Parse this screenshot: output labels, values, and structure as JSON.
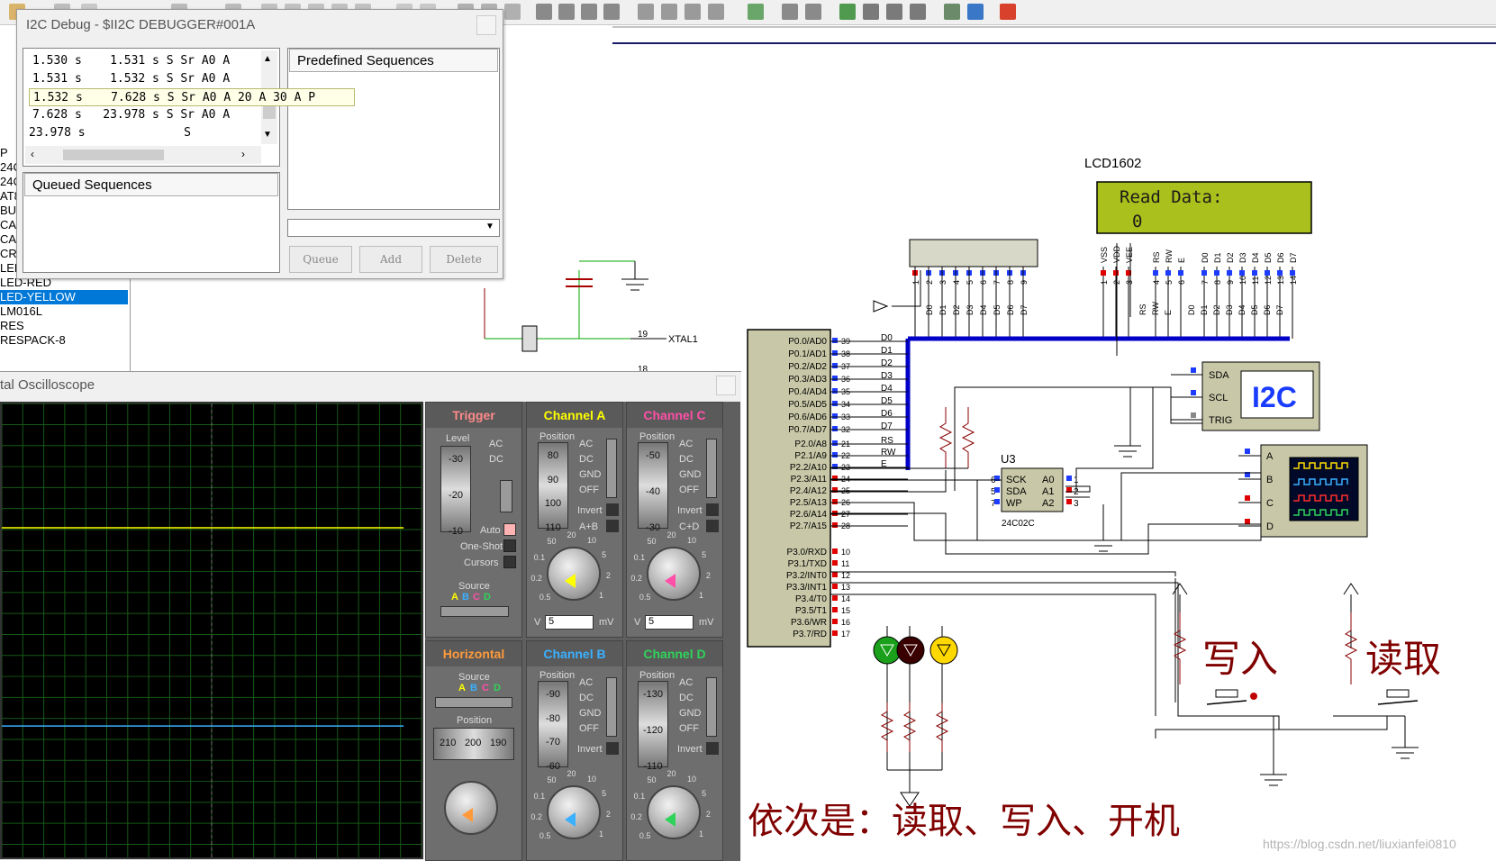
{
  "toolbar": {
    "label": "schematic-toolbar"
  },
  "i2c_window": {
    "title": "I2C Debug - $II2C DEBUGGER#001A",
    "trace_rows": [
      "1.530 s    1.531 s S Sr A0 A",
      "1.531 s    1.532 s S Sr A0 A",
      "1.532 s    7.628 s S Sr A0 A 20 A 30 A P",
      "7.628 s   23.978 s S Sr A0 A",
      "23.978 s              S"
    ],
    "predefined_label": "Predefined Sequences",
    "queued_label": "Queued Sequences",
    "buttons": {
      "queue": "Queue",
      "add": "Add",
      "delete": "Delete"
    }
  },
  "component_list": {
    "items": [
      "P",
      "24C",
      "24C",
      "AT8",
      "BUT",
      "CAR",
      "CAR",
      "CRY",
      "LED-GREEN",
      "LED-RED",
      "LED-YELLOW",
      "LM016L",
      "RES",
      "RESPACK-8"
    ],
    "selected_index": 10
  },
  "oscilloscope": {
    "title": "tal Oscilloscope",
    "trigger": {
      "title": "Trigger",
      "level_label": "Level",
      "ac": "AC",
      "dc": "DC",
      "auto": "Auto",
      "one_shot": "One-Shot",
      "cursors": "Cursors",
      "source": "Source",
      "scale": [
        "-30",
        "-20",
        "-10"
      ]
    },
    "horizontal": {
      "title": "Horizontal",
      "source": "Source",
      "position": "Position",
      "scale": [
        "210",
        "200",
        "190"
      ]
    },
    "source_letters": [
      "A",
      "B",
      "C",
      "D"
    ],
    "channels": [
      {
        "title": "Channel A",
        "color": "#ffff00",
        "position": "Position",
        "scale": [
          "80",
          "90",
          "100",
          "110"
        ],
        "coupling": [
          "AC",
          "DC",
          "GND",
          "OFF"
        ],
        "invert": "Invert",
        "extra": "A+B",
        "volts": "5",
        "unit_left": "V",
        "unit_right": "mV"
      },
      {
        "title": "Channel C",
        "color": "#ff4fa8",
        "position": "Position",
        "scale": [
          "-50",
          "-40",
          "-30"
        ],
        "coupling": [
          "AC",
          "DC",
          "GND",
          "OFF"
        ],
        "invert": "Invert",
        "extra": "C+D",
        "volts": "5",
        "unit_left": "V",
        "unit_right": "mV"
      },
      {
        "title": "Channel B",
        "color": "#3ab0ff",
        "position": "Position",
        "scale": [
          "-90",
          "-80",
          "-70",
          "-60"
        ],
        "coupling": [
          "AC",
          "DC",
          "GND",
          "OFF"
        ],
        "invert": "Invert"
      },
      {
        "title": "Channel D",
        "color": "#2fd35a",
        "position": "Position",
        "scale": [
          "-130",
          "-120",
          "-110"
        ],
        "coupling": [
          "AC",
          "DC",
          "GND",
          "OFF"
        ],
        "invert": "Invert"
      }
    ],
    "dial_labels": [
      "0.5",
      "0.2",
      "0.1",
      "50",
      "20",
      "10",
      "5",
      "2",
      "1"
    ]
  },
  "schematic": {
    "lcd_label": "LCD1602",
    "lcd_line1": "Read Data:",
    "lcd_line2": "0",
    "mcu_pins_left": [
      "19",
      "18"
    ],
    "xtal1": "XTAL1",
    "p0_pins": [
      "P0.0/AD0",
      "P0.1/AD1",
      "P0.2/AD2",
      "P0.3/AD3",
      "P0.4/AD4",
      "P0.5/AD5",
      "P0.6/AD6",
      "P0.7/AD7"
    ],
    "p0_nums": [
      "39",
      "38",
      "37",
      "36",
      "35",
      "34",
      "33",
      "32"
    ],
    "p0_nets": [
      "D0",
      "D1",
      "D2",
      "D3",
      "D4",
      "D5",
      "D6",
      "D7"
    ],
    "p2_pins": [
      "P2.0/A8",
      "P2.1/A9",
      "P2.2/A10",
      "P2.3/A11",
      "P2.4/A12",
      "P2.5/A13",
      "P2.6/A14",
      "P2.7/A15"
    ],
    "p2_nums": [
      "21",
      "22",
      "23",
      "24",
      "25",
      "26",
      "27",
      "28"
    ],
    "p2_nets": [
      "RS",
      "RW",
      "E"
    ],
    "p3_pins": [
      "P3.0/RXD",
      "P3.1/TXD",
      "P3.2/INT0",
      "P3.3/INT1",
      "P3.4/T0",
      "P3.5/T1",
      "P3.6/WR",
      "P3.7/RD"
    ],
    "p3_nums": [
      "10",
      "11",
      "12",
      "13",
      "14",
      "15",
      "16",
      "17"
    ],
    "eeprom": {
      "ref": "U3",
      "part": "24C02C",
      "pins_left": [
        "SCK",
        "SDA",
        "WP"
      ],
      "pins_left_nums": [
        "6",
        "5",
        "7"
      ],
      "pins_right": [
        "A0",
        "A1",
        "A2"
      ],
      "pins_right_nums": [
        "1",
        "2",
        "3"
      ]
    },
    "i2c_dbg": {
      "label": "I2C",
      "pins": [
        "SDA",
        "SCL",
        "TRIG"
      ]
    },
    "scope_pins": [
      "A",
      "B",
      "C",
      "D"
    ],
    "lcd_pins": [
      "VSS",
      "VDD",
      "VEE",
      "RS",
      "RW",
      "E",
      "D0",
      "D1",
      "D2",
      "D3",
      "D4",
      "D5",
      "D6",
      "D7"
    ],
    "lcd_pin_nums": [
      "1",
      "2",
      "3",
      "4",
      "5",
      "6",
      "7",
      "8",
      "9",
      "10",
      "11",
      "12",
      "13",
      "14"
    ],
    "header_pins": [
      "D0",
      "D1",
      "D2",
      "D3",
      "D4",
      "D5",
      "D6",
      "D7"
    ],
    "header_nums": [
      "1",
      "2",
      "3",
      "4",
      "5",
      "6",
      "7",
      "8",
      "9"
    ],
    "lcd_bottom_labels": [
      "RS",
      "RW",
      "E",
      "D0",
      "D1",
      "D2",
      "D3",
      "D4",
      "D5",
      "D6",
      "D7"
    ],
    "write_label": "写入",
    "read_label": "读取",
    "note": "依次是：读取、写入、开机",
    "watermark": "https://blog.csdn.net/liuxianfei0810"
  }
}
